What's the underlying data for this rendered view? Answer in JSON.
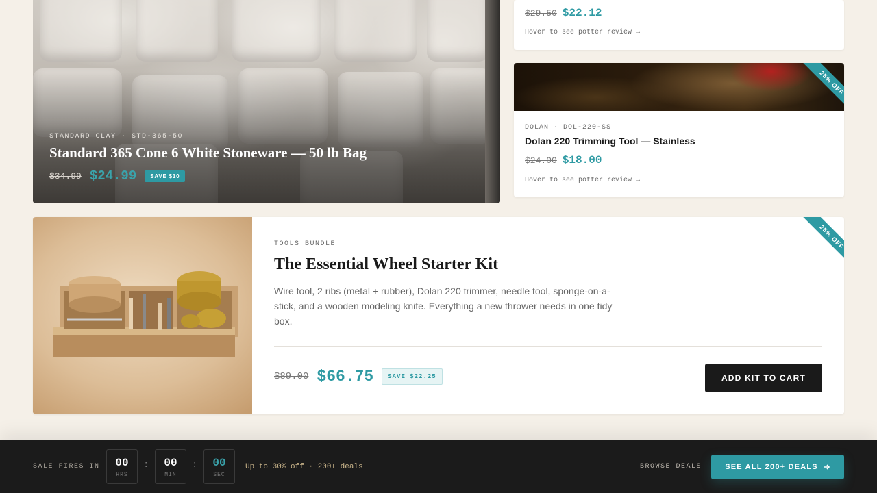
{
  "hero": {
    "meta": "STANDARD CLAY · STD-365-50",
    "title": "Standard 365 Cone 6 White Stoneware — 50 lb Bag",
    "old_price": "$34.99",
    "new_price": "$24.99",
    "badge": "SAVE $10"
  },
  "card_top": {
    "old_price": "$29.50",
    "new_price": "$22.12",
    "hint": "Hover to see potter review →"
  },
  "card_dolan": {
    "ribbon": "25% OFF",
    "meta": "DOLAN · DOL-220-SS",
    "name": "Dolan 220 Trimming Tool — Stainless",
    "old_price": "$24.00",
    "new_price": "$18.00",
    "hint": "Hover to see potter review →"
  },
  "kit": {
    "ribbon": "25% OFF",
    "meta": "TOOLS BUNDLE",
    "title": "The Essential Wheel Starter Kit",
    "description": "Wire tool, 2 ribs (metal + rubber), Dolan 220 trimmer, needle tool, sponge-on-a-stick, and a wooden modeling knife. Everything a new thrower needs in one tidy box.",
    "old_price": "$89.00",
    "new_price": "$66.75",
    "badge": "SAVE $22.25",
    "button": "ADD KIT TO CART"
  },
  "countdown": {
    "label": "SALE FIRES IN",
    "hours": "00",
    "hours_unit": "HRS",
    "minutes": "00",
    "minutes_unit": "MIN",
    "seconds": "00",
    "seconds_unit": "SEC",
    "separator": ":",
    "note": "Up to 30% off · 200+ deals",
    "browse": "BROWSE DEALS",
    "button": "SEE ALL 200+ DEALS",
    "button_icon": "arrow-right-icon"
  },
  "colors": {
    "accent": "#2e9aa3",
    "background": "#f5f0e8",
    "bar": "#1b1b1b"
  }
}
